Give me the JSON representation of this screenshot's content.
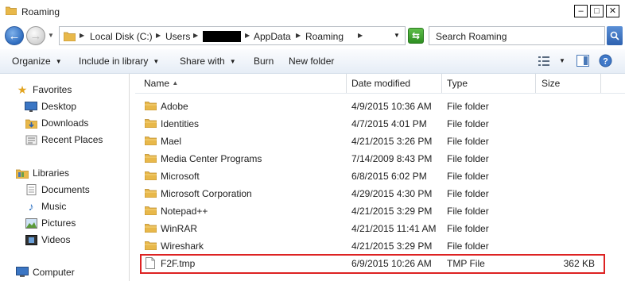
{
  "window": {
    "title": "Roaming"
  },
  "address": {
    "segments": [
      "Local Disk (C:)",
      "Users",
      "AppData",
      "Roaming"
    ],
    "search_placeholder": "Search Roaming"
  },
  "toolbar": {
    "organize": "Organize",
    "include_in_library": "Include in library",
    "share_with": "Share with",
    "burn": "Burn",
    "new_folder": "New folder"
  },
  "nav": {
    "favorites": "Favorites",
    "desktop": "Desktop",
    "downloads": "Downloads",
    "recent_places": "Recent Places",
    "libraries": "Libraries",
    "documents": "Documents",
    "music": "Music",
    "pictures": "Pictures",
    "videos": "Videos",
    "computer": "Computer"
  },
  "columns": {
    "name": "Name",
    "date_modified": "Date modified",
    "type": "Type",
    "size": "Size"
  },
  "files": [
    {
      "name": "Adobe",
      "date": "4/9/2015 10:36 AM",
      "type": "File folder",
      "size": ""
    },
    {
      "name": "Identities",
      "date": "4/7/2015 4:01 PM",
      "type": "File folder",
      "size": ""
    },
    {
      "name": "Mael",
      "date": "4/21/2015 3:26 PM",
      "type": "File folder",
      "size": ""
    },
    {
      "name": "Media Center Programs",
      "date": "7/14/2009 8:43 PM",
      "type": "File folder",
      "size": ""
    },
    {
      "name": "Microsoft",
      "date": "6/8/2015 6:02 PM",
      "type": "File folder",
      "size": ""
    },
    {
      "name": "Microsoft Corporation",
      "date": "4/29/2015 4:30 PM",
      "type": "File folder",
      "size": ""
    },
    {
      "name": "Notepad++",
      "date": "4/21/2015 3:29 PM",
      "type": "File folder",
      "size": ""
    },
    {
      "name": "WinRAR",
      "date": "4/21/2015 11:41 AM",
      "type": "File folder",
      "size": ""
    },
    {
      "name": "Wireshark",
      "date": "4/21/2015 3:29 PM",
      "type": "File folder",
      "size": ""
    },
    {
      "name": "F2F.tmp",
      "date": "6/9/2015 10:26 AM",
      "type": "TMP File",
      "size": "362 KB"
    }
  ],
  "colors": {
    "highlight_border": "#dd2222",
    "folder": "#e8b84a"
  }
}
